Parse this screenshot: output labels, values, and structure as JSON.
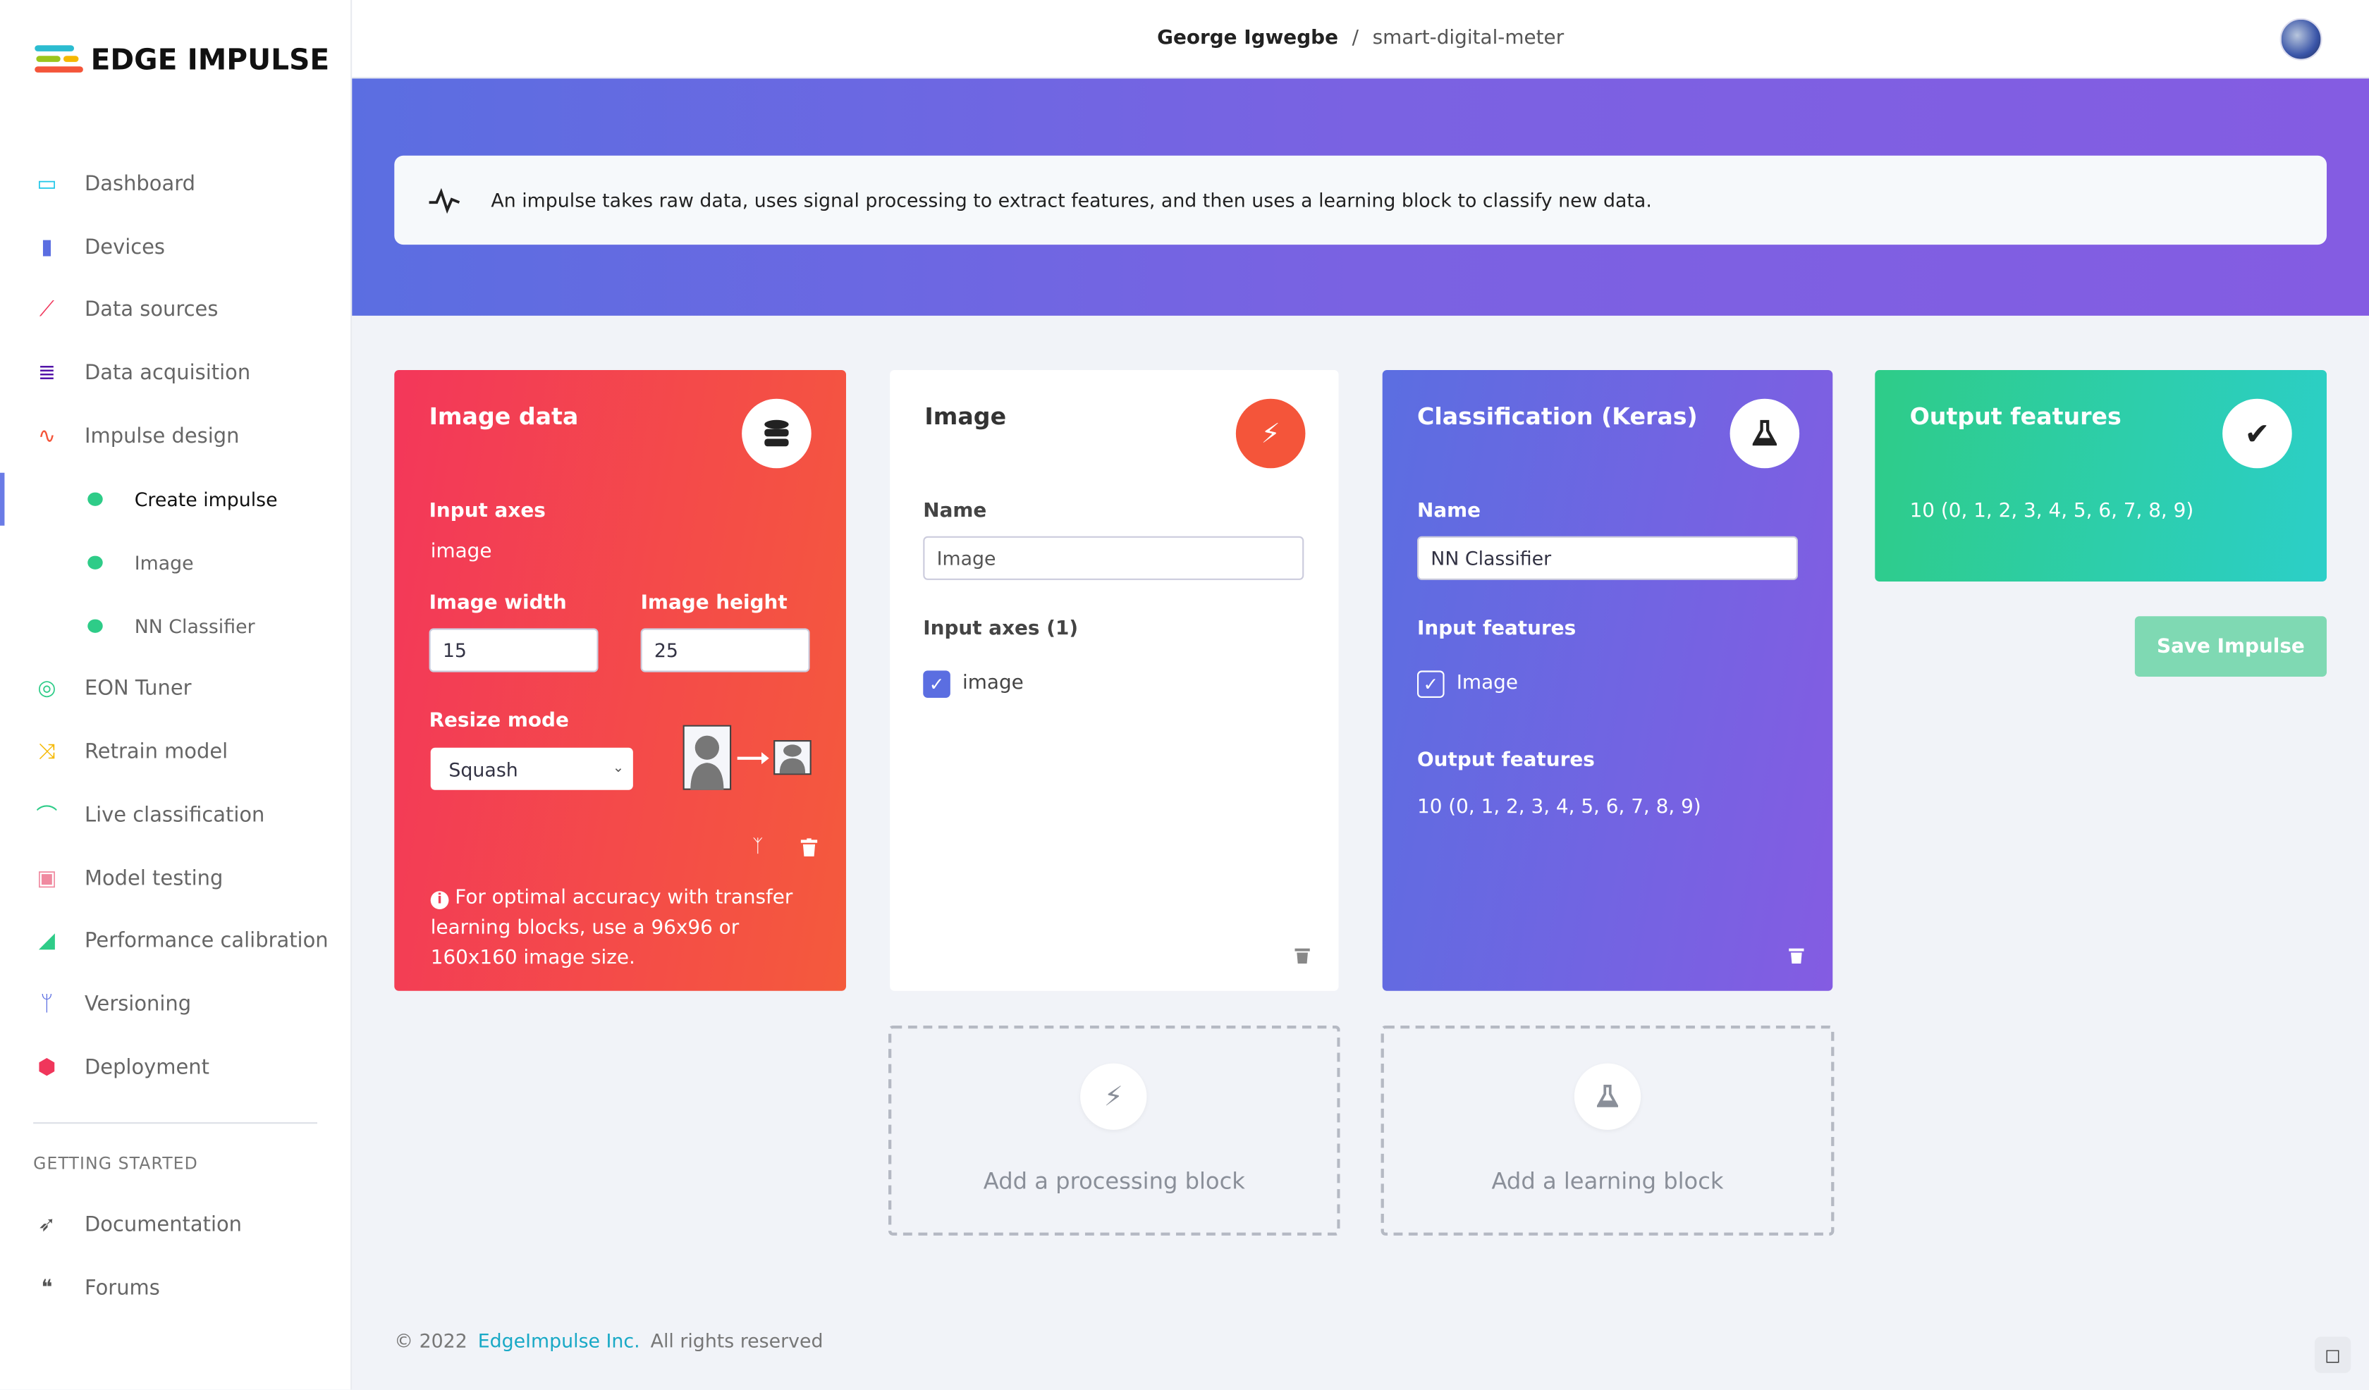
{
  "brand": {
    "name": "EDGE IMPULSE"
  },
  "sidebar": {
    "items": [
      {
        "label": "Dashboard",
        "icon": "monitor-icon",
        "color": "#1fc7e8"
      },
      {
        "label": "Devices",
        "icon": "chip-icon",
        "color": "#5b6ee1"
      },
      {
        "label": "Data sources",
        "icon": "magic-wand-icon",
        "color": "#f0365b"
      },
      {
        "label": "Data acquisition",
        "icon": "database-icon",
        "color": "#5213a8"
      },
      {
        "label": "Impulse design",
        "icon": "pulse-icon",
        "color": "#f4553a"
      },
      {
        "label": "EON Tuner",
        "icon": "compass-icon",
        "color": "#2ecc88"
      },
      {
        "label": "Retrain model",
        "icon": "shuffle-icon",
        "color": "#f5b800"
      },
      {
        "label": "Live classification",
        "icon": "live-icon",
        "color": "#2ecc88"
      },
      {
        "label": "Model testing",
        "icon": "clipboard-check-icon",
        "color": "#f08aa0"
      },
      {
        "label": "Performance calibration",
        "icon": "chart-area-icon",
        "color": "#2ecc88"
      },
      {
        "label": "Versioning",
        "icon": "branch-icon",
        "color": "#5b6ee1"
      },
      {
        "label": "Deployment",
        "icon": "cube-icon",
        "color": "#f0365b"
      }
    ],
    "subitems": [
      {
        "label": "Create impulse",
        "active": true
      },
      {
        "label": "Image"
      },
      {
        "label": "NN Classifier"
      }
    ],
    "section_title": "GETTING STARTED",
    "getting_started": [
      {
        "label": "Documentation",
        "icon": "rocket-icon"
      },
      {
        "label": "Forums",
        "icon": "comments-icon"
      }
    ]
  },
  "header": {
    "user": "George Igwegbe",
    "separator": "/",
    "project": "smart-digital-meter"
  },
  "banner": {
    "text": "An impulse takes raw data, uses signal processing to extract features, and then uses a learning block to classify new data.",
    "close": "×"
  },
  "cards": {
    "input": {
      "title": "Image data",
      "input_axes_label": "Input axes",
      "input_axes_value": "image",
      "width_label": "Image width",
      "width_value": "15",
      "height_label": "Image height",
      "height_value": "25",
      "resize_label": "Resize mode",
      "resize_value": "Squash",
      "info": "For optimal accuracy with transfer learning blocks, use a 96x96 or 160x160 image size."
    },
    "processing": {
      "title": "Image",
      "name_label": "Name",
      "name_value": "Image",
      "axes_label": "Input axes (1)",
      "axes": [
        {
          "label": "image",
          "checked": true
        }
      ]
    },
    "learning": {
      "title": "Classification (Keras)",
      "name_label": "Name",
      "name_value": "NN Classifier",
      "features_label": "Input features",
      "features": [
        {
          "label": "Image",
          "checked": true
        }
      ],
      "output_label": "Output features",
      "output_value": "10 (0, 1, 2, 3, 4, 5, 6, 7, 8, 9)"
    },
    "output": {
      "title": "Output features",
      "value": "10 (0, 1, 2, 3, 4, 5, 6, 7, 8, 9)"
    }
  },
  "save_button": "Save Impulse",
  "add_processing": "Add a processing block",
  "add_learning": "Add a learning block",
  "footer": {
    "copyright": "© 2022",
    "company": "EdgeImpulse Inc.",
    "rights": "All rights reserved"
  },
  "colors": {
    "accent": "#5b6ee1",
    "save": "#7fd9b3",
    "link": "#19a9c6"
  }
}
